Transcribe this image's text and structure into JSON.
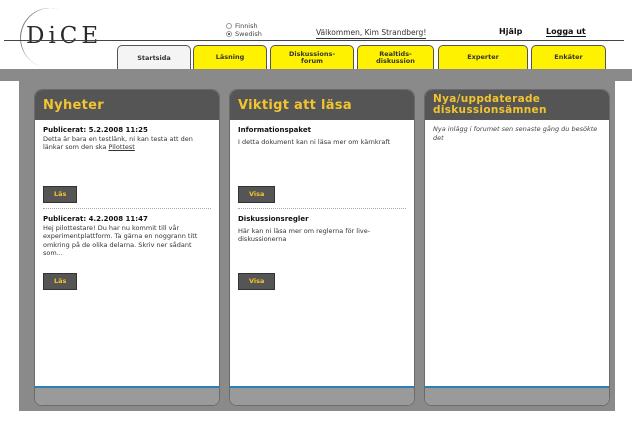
{
  "logo": {
    "text": "DiCE"
  },
  "language": {
    "options": [
      "Finnish",
      "Swedish"
    ],
    "selected": "Swedish"
  },
  "header": {
    "welcome": "Välkommen, Kim Strandberg!",
    "help": "Hjälp",
    "logout": "Logga ut"
  },
  "tabs": [
    {
      "label": "Startsida"
    },
    {
      "label": "Läsning"
    },
    {
      "label": "Diskussions-\nforum"
    },
    {
      "label": "Realtids-\ndiskussion"
    },
    {
      "label": "Experter"
    },
    {
      "label": "Enkäter"
    }
  ],
  "news": {
    "title": "Nyheter",
    "items": [
      {
        "date": "Publicerat: 5.2.2008 11:25",
        "text": "Detta är bara en testlänk, ni kan testa att den länkar som den ska ",
        "link": "Pilottest",
        "button": "Läs"
      },
      {
        "date": "Publicerat: 4.2.2008 11:47",
        "text": "Hej pilottestare! Du har nu kommit till vår experimentplattform. Ta gärna en noggrann titt omkring på de olika delarna. Skriv ner sådant som...",
        "button": "Läs"
      }
    ]
  },
  "important": {
    "title": "Viktigt att läsa",
    "items": [
      {
        "title": "Informationspaket",
        "text": "I detta dokument kan ni läsa mer om kärnkraft",
        "button": "Visa"
      },
      {
        "title": "Diskussionsregler",
        "text": "Här kan ni läsa mer om reglerna för live-diskussionerna",
        "button": "Visa"
      }
    ]
  },
  "topics": {
    "title_line1": "Nya/uppdaterade",
    "title_line2": "diskussionsämnen",
    "text": "Nya inlägg i forumet sen senaste gång du besökte det"
  }
}
